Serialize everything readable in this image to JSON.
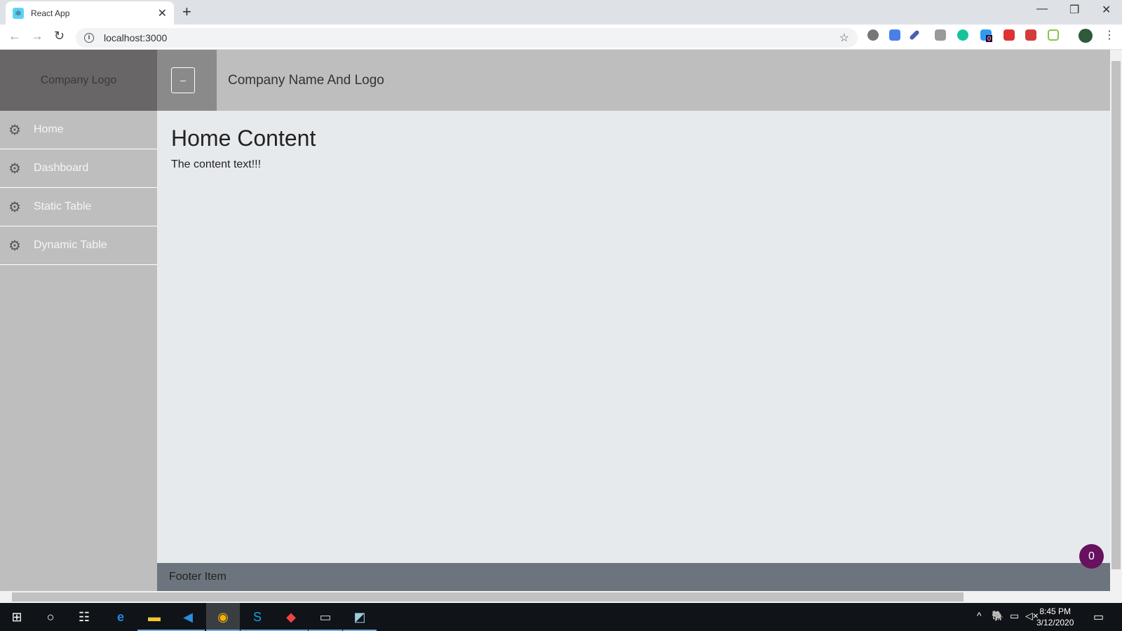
{
  "browser": {
    "tab_title": "React App",
    "url": "localhost:3000",
    "extension_badge": "0"
  },
  "app": {
    "logo": "Company Logo",
    "toggle_label": "–",
    "header_title": "Company Name And Logo",
    "sidebar": {
      "items": [
        {
          "label": "Home",
          "icon": "gear-icon"
        },
        {
          "label": "Dashboard",
          "icon": "gear-icon"
        },
        {
          "label": "Static Table",
          "icon": "gear-icon"
        },
        {
          "label": "Dynamic Table",
          "icon": "gear-icon"
        }
      ]
    },
    "content": {
      "title": "Home Content",
      "text": "The content text!!!"
    },
    "footer": "Footer Item",
    "badge": "0"
  },
  "colors": {
    "badge": "#67115f",
    "footer": "#6c757d",
    "logo_bg": "#686667",
    "header_bg": "#bebebe"
  },
  "taskbar": {
    "time": "8:45 PM",
    "date": "3/12/2020"
  }
}
